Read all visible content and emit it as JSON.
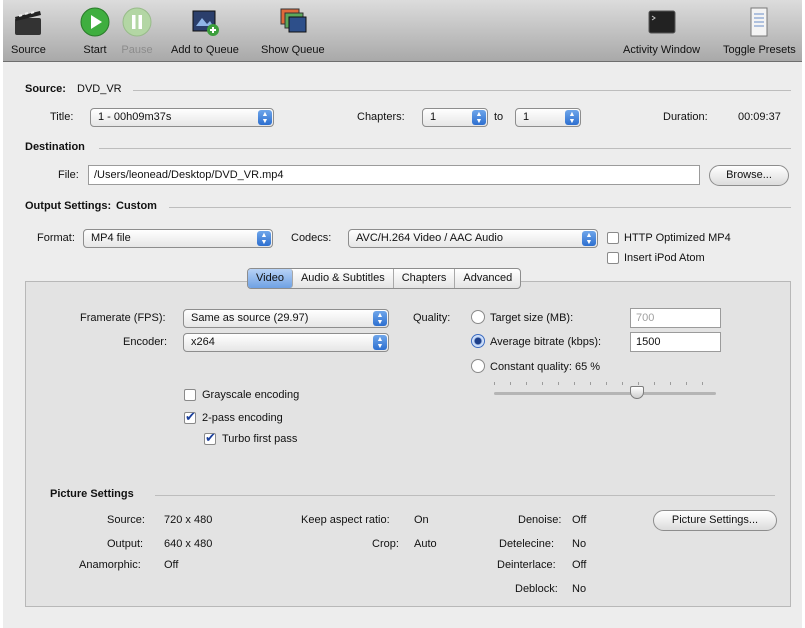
{
  "toolbar": {
    "source": "Source",
    "start": "Start",
    "pause": "Pause",
    "add_to_queue": "Add to Queue",
    "show_queue": "Show Queue",
    "activity_window": "Activity Window",
    "toggle_presets": "Toggle Presets"
  },
  "source": {
    "label": "Source:",
    "value": "DVD_VR"
  },
  "title": {
    "label": "Title:",
    "value": "1 - 00h09m37s"
  },
  "chapters": {
    "label": "Chapters:",
    "from": "1",
    "to_label": "to",
    "to": "1"
  },
  "duration": {
    "label": "Duration:",
    "value": "00:09:37"
  },
  "destination": {
    "heading": "Destination",
    "file_label": "File:",
    "file_value": "/Users/leonead/Desktop/DVD_VR.mp4",
    "browse": "Browse..."
  },
  "output": {
    "heading": "Output Settings:",
    "preset": "Custom",
    "format_label": "Format:",
    "format_value": "MP4 file",
    "codecs_label": "Codecs:",
    "codecs_value": "AVC/H.264 Video / AAC Audio",
    "http_optimized": "HTTP Optimized MP4",
    "http_optimized_checked": false,
    "ipod_atom": "Insert iPod Atom",
    "ipod_atom_checked": false
  },
  "tabs": {
    "video": "Video",
    "audio": "Audio & Subtitles",
    "chapters": "Chapters",
    "advanced": "Advanced",
    "active": "Video"
  },
  "video": {
    "framerate_label": "Framerate (FPS):",
    "framerate_value": "Same as source (29.97)",
    "encoder_label": "Encoder:",
    "encoder_value": "x264",
    "quality_label": "Quality:",
    "target_size_label": "Target size (MB):",
    "target_size_value": "700",
    "avg_bitrate_label": "Average bitrate (kbps):",
    "avg_bitrate_value": "1500",
    "constant_quality_label": "Constant quality: 65 %",
    "quality_mode": "average_bitrate",
    "quality_slider_fraction": 0.65,
    "grayscale": "Grayscale encoding",
    "grayscale_checked": false,
    "two_pass": "2-pass encoding",
    "two_pass_checked": true,
    "turbo": "Turbo first pass",
    "turbo_checked": true
  },
  "picture": {
    "heading": "Picture Settings",
    "source_label": "Source:",
    "source_value": "720 x 480",
    "output_label": "Output:",
    "output_value": "640 x 480",
    "anamorphic_label": "Anamorphic:",
    "anamorphic_value": "Off",
    "keep_aspect_label": "Keep aspect ratio:",
    "keep_aspect_value": "On",
    "crop_label": "Crop:",
    "crop_value": "Auto",
    "denoise_label": "Denoise:",
    "denoise_value": "Off",
    "detelecine_label": "Detelecine:",
    "detelecine_value": "No",
    "deinterlace_label": "Deinterlace:",
    "deinterlace_value": "Off",
    "deblock_label": "Deblock:",
    "deblock_value": "No",
    "button": "Picture Settings..."
  }
}
